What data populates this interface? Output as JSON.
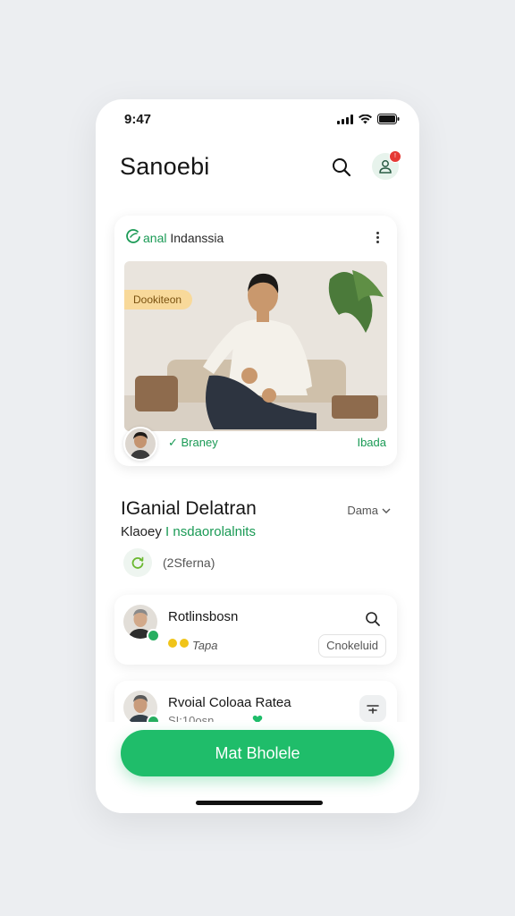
{
  "status_bar": {
    "time": "9:47"
  },
  "header": {
    "title": "Sanoebi",
    "notification_count": "!"
  },
  "feature_card": {
    "brand_green": "anal",
    "brand_dark": "Indanssia",
    "tag": "Dookiteon",
    "verified_label": "✓ Braney",
    "right_label": "Ibada"
  },
  "detail": {
    "title": "IGanial Delatran",
    "sort_label": "Dama",
    "sub_dark": "Klaoey",
    "sub_green": "I nsdaorolalnits",
    "chip_text": "(2Sferna)"
  },
  "list": [
    {
      "name": "Rotlinsbosn",
      "tag": "Tapa",
      "pill": "Cnokeluid"
    },
    {
      "name": "Rvoial Coloaa Ratea",
      "sub": "SI:10osn"
    }
  ],
  "cta": {
    "label": "Mat Bholele"
  },
  "colors": {
    "accent": "#1fbd6a",
    "accent_text": "#1a9a55",
    "tag_bg": "#f8d99a",
    "notif": "#e53935"
  },
  "icons": [
    "search-icon",
    "profile-icon",
    "more-vertical-icon",
    "check-icon",
    "leaf-icon",
    "chevron-down-icon",
    "heart-icon",
    "filter-icon"
  ]
}
